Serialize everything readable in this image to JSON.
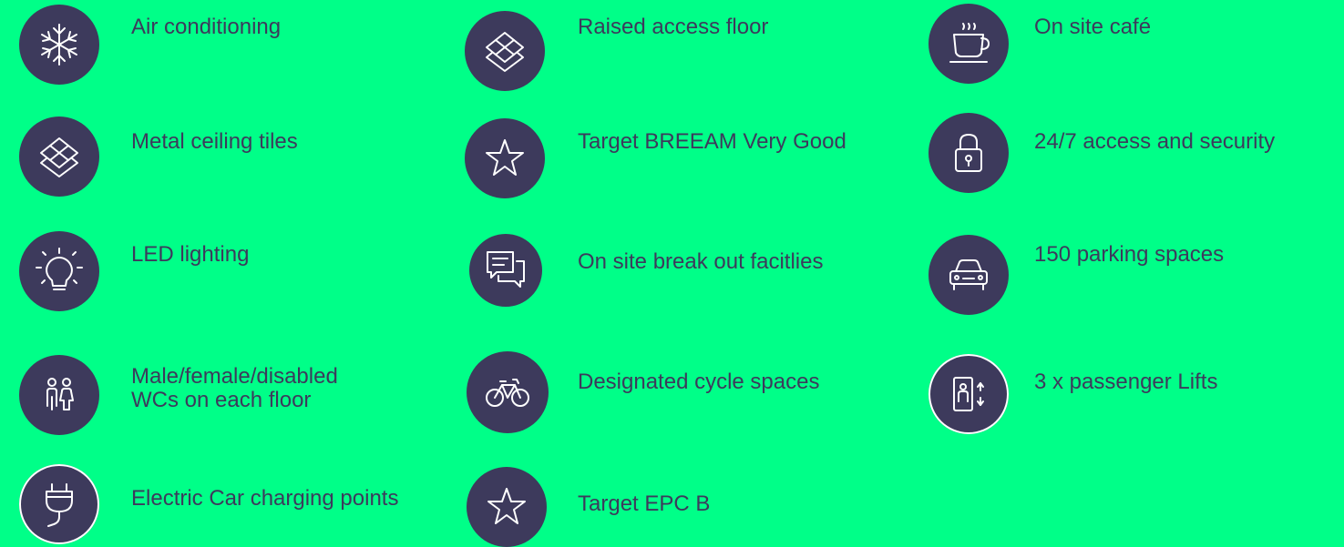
{
  "colors": {
    "background": "#00FF88",
    "icon_circle": "#3D3A5C",
    "icon_stroke": "#FFFFFF",
    "text": "#3D3A5C"
  },
  "features": {
    "air_conditioning": {
      "label": "Air conditioning",
      "icon": "snowflake-icon"
    },
    "raised_access_floor": {
      "label": "Raised access floor",
      "icon": "layers-icon"
    },
    "on_site_cafe": {
      "label": "On site café",
      "icon": "coffee-cup-icon"
    },
    "metal_ceiling_tiles": {
      "label": "Metal ceiling tiles",
      "icon": "layers-icon"
    },
    "target_breeam": {
      "label": "Target BREEAM Very Good",
      "icon": "star-icon"
    },
    "access_security": {
      "label": "24/7 access and security",
      "icon": "padlock-icon"
    },
    "led_lighting": {
      "label": "LED lighting",
      "icon": "lightbulb-icon"
    },
    "break_out": {
      "label": "On site break out facitlies",
      "icon": "chat-bubbles-icon"
    },
    "parking": {
      "label": "150 parking spaces",
      "icon": "car-icon"
    },
    "wcs": {
      "label_line1": "Male/female/disabled",
      "label_line2": "WCs on each floor",
      "icon": "toilets-icon"
    },
    "cycle_spaces": {
      "label": "Designated cycle spaces",
      "icon": "bicycle-icon"
    },
    "lifts": {
      "label": "3 x passenger Lifts",
      "icon": "lift-icon"
    },
    "ev_charging": {
      "label": "Electric Car charging points",
      "icon": "plug-icon"
    },
    "target_epc": {
      "label": "Target EPC B",
      "icon": "star-icon"
    }
  }
}
